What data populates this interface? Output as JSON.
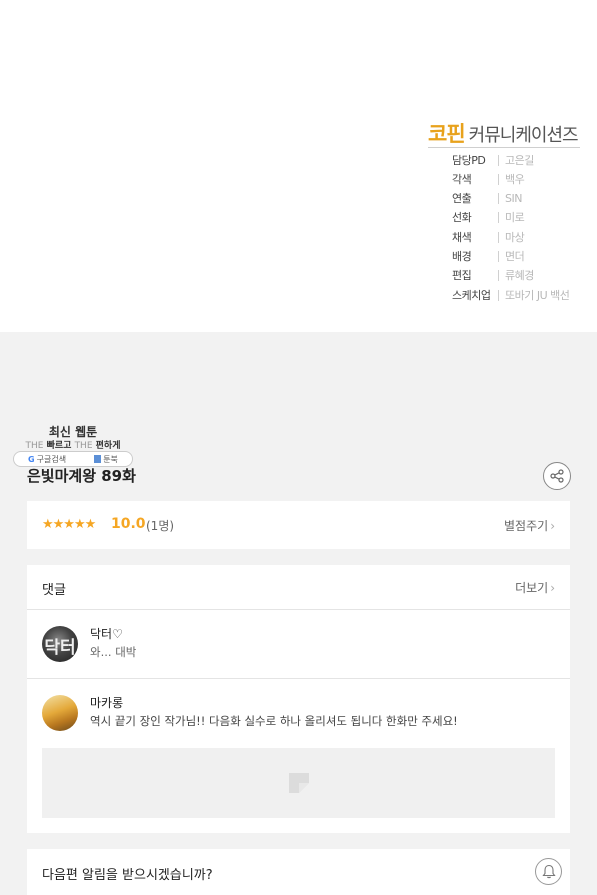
{
  "credits": {
    "studio_brand": "코핀",
    "studio_rest": "커뮤니케이션즈",
    "rows": [
      {
        "role": "담당PD",
        "name": "고은길"
      },
      {
        "role": "각색",
        "name": "백우"
      },
      {
        "role": "연출",
        "name": "SIN"
      },
      {
        "role": "선화",
        "name": "미로"
      },
      {
        "role": "채색",
        "name": "마상"
      },
      {
        "role": "배경",
        "name": "면더"
      },
      {
        "role": "편집",
        "name": "류혜경"
      },
      {
        "role": "스케치업",
        "name": "또바기  JU  백선"
      }
    ]
  },
  "ad": {
    "title": "최신 웹툰",
    "sub_the1": "THE",
    "sub_fast": "빠르고",
    "sub_the2": "THE",
    "sub_easy": "편하게",
    "google_label": "구글검색",
    "book_label": "툰북"
  },
  "episode": {
    "title": "은빛마계왕 89화"
  },
  "rating": {
    "stars": "★★★★★",
    "score": "10.0",
    "count": "(1명)",
    "rate_link": "별점주기"
  },
  "comments": {
    "title": "댓글",
    "more_link": "더보기",
    "items": [
      {
        "author": "닥터♡",
        "body": "와... 대박",
        "avatar_glyph": "닥터"
      },
      {
        "author": "마카롱",
        "body": "역시 끝기 장인 작가님!! 다음화 실수로 하나 올리셔도 됩니다 한화만 주세요!",
        "avatar_glyph": ""
      }
    ]
  },
  "notify": {
    "text": "다음편 알림을 받으시겠습니까?"
  },
  "colors": {
    "accent_star": "#f5a623",
    "studio_brand": "#e8a21c",
    "page_bg": "#f2f2f2",
    "card_bg": "#ffffff"
  }
}
